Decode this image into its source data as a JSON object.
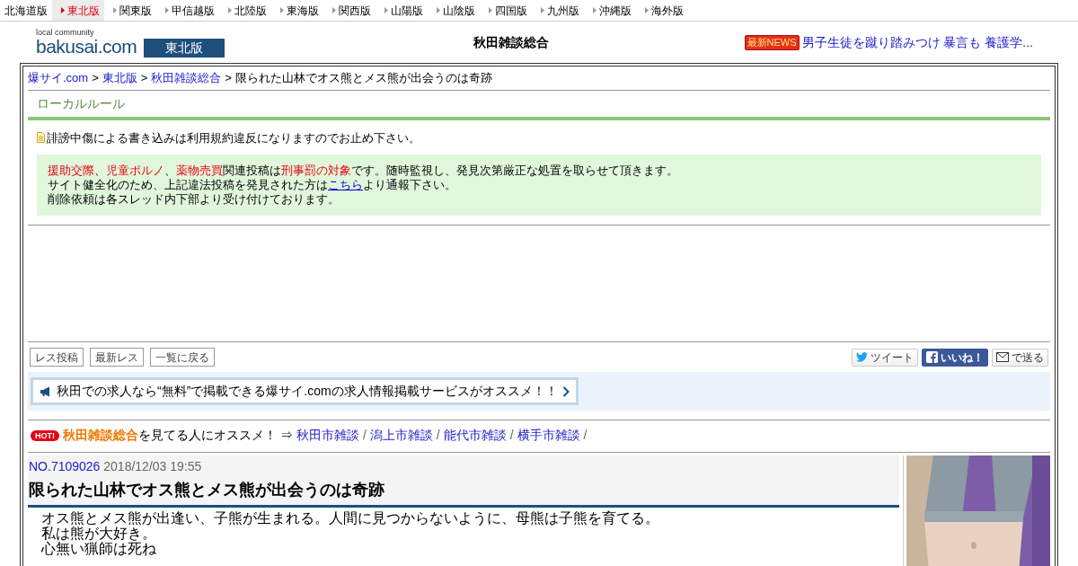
{
  "region_tabs": [
    {
      "label": "北海道版",
      "selected": false
    },
    {
      "label": "東北版",
      "selected": true
    },
    {
      "label": "関東版",
      "selected": false
    },
    {
      "label": "甲信越版",
      "selected": false
    },
    {
      "label": "北陸版",
      "selected": false
    },
    {
      "label": "東海版",
      "selected": false
    },
    {
      "label": "関西版",
      "selected": false
    },
    {
      "label": "山陽版",
      "selected": false
    },
    {
      "label": "山陰版",
      "selected": false
    },
    {
      "label": "四国版",
      "selected": false
    },
    {
      "label": "九州版",
      "selected": false
    },
    {
      "label": "沖縄版",
      "selected": false
    },
    {
      "label": "海外版",
      "selected": false
    }
  ],
  "header": {
    "logo_tagline": "local community",
    "logo": "bakusai.com",
    "edition": "東北版",
    "board_title": "秋田雑談総合",
    "news_badge": "最新NEWS",
    "news_link": "男子生徒を蹴り踏みつけ 暴言も 養護学..."
  },
  "breadcrumb": {
    "links": [
      "爆サイ.com",
      "東北版",
      "秋田雑談総合"
    ],
    "separator": ">",
    "current": "限られた山林でオス熊とメス熊が出会うのは奇跡"
  },
  "local_rules": {
    "title": "ローカルルール",
    "warning": "誹謗中傷による書き込みは利用規約違反になりますのでお止め下さい。",
    "notice_lines": [
      [
        {
          "kind": "red",
          "text": "援助交際"
        },
        {
          "kind": "plain",
          "text": "、"
        },
        {
          "kind": "red",
          "text": "児童ポルノ"
        },
        {
          "kind": "plain",
          "text": "、"
        },
        {
          "kind": "red",
          "text": "薬物売買"
        },
        {
          "kind": "plain",
          "text": "関連投稿は"
        },
        {
          "kind": "red",
          "text": "刑事罰の対象"
        },
        {
          "kind": "plain",
          "text": "です。随時監視し、発見次第厳正な処置を取らせて頂きます。"
        }
      ],
      [
        {
          "kind": "plain",
          "text": "サイト健全化のため、上記違法投稿を発見された方は"
        },
        {
          "kind": "link",
          "text": "こちら"
        },
        {
          "kind": "plain",
          "text": "より通報下さい。"
        }
      ],
      [
        {
          "kind": "plain",
          "text": "削除依頼は各スレッド内下部より受け付けております。"
        }
      ]
    ]
  },
  "actions": [
    "レス投稿",
    "最新レス",
    "一覧に戻る"
  ],
  "share": [
    {
      "kind": "twitter",
      "label": "ツイート"
    },
    {
      "kind": "facebook",
      "label": "いいね！"
    },
    {
      "kind": "mail",
      "label": "で送る"
    }
  ],
  "job_banner": "秋田での求人なら“無料”で掲載できる爆サイ.comの求人情報掲載サービスがオススメ！！",
  "recommend": {
    "badge": "HOT!",
    "board": "秋田雑談総合",
    "text": "を見てる人にオススメ！ ⇒",
    "links": [
      "秋田市雑談",
      "潟上市雑談",
      "能代市雑談",
      "横手市雑談"
    ],
    "separator": "/"
  },
  "thread": {
    "number": "NO.7109026",
    "date": "2018/12/03 19:55",
    "title": "限られた山林でオス熊とメス熊が出会うのは奇跡",
    "body": [
      "オス熊とメス熊が出逢い、子熊が生まれる。人間に見つからないように、母熊は子熊を育てる。",
      "私は熊が大好き。",
      "心無い猟師は死ね"
    ]
  },
  "ad": {
    "kind": "picture"
  }
}
